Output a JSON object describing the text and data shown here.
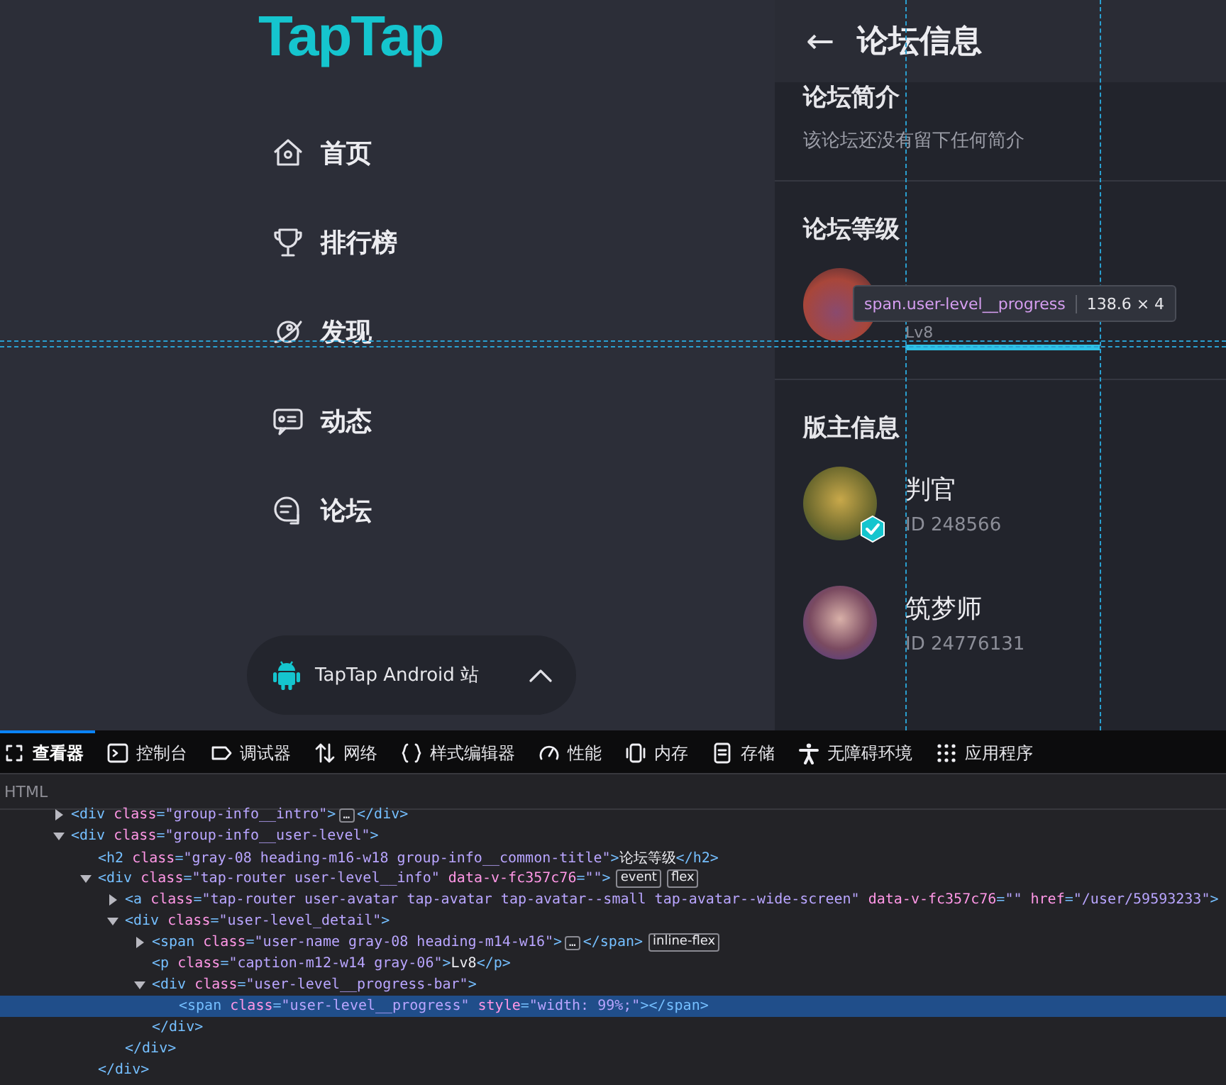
{
  "sidebar": {
    "logo": "TapTap",
    "nav_items": [
      {
        "kind": "home",
        "label": "首页"
      },
      {
        "kind": "trophy",
        "label": "排行榜"
      },
      {
        "kind": "planet",
        "label": "发现"
      },
      {
        "kind": "feed",
        "label": "动态"
      },
      {
        "kind": "forum",
        "label": "论坛"
      }
    ],
    "platform_switch": {
      "label": "TapTap Android 站",
      "expanded": false
    }
  },
  "panel": {
    "back": "←",
    "title": "论坛信息",
    "intro": {
      "heading": "论坛简介",
      "text": "该论坛还没有留下任何简介"
    },
    "level": {
      "heading": "论坛等级",
      "caption": "Lv8",
      "level": 0.99
    },
    "moderators": {
      "heading": "版主信息",
      "items": [
        {
          "name": "判官",
          "id": "ID 248566",
          "verified": true
        },
        {
          "name": "筑梦师",
          "id": "ID 24776131",
          "verified": false
        }
      ]
    }
  },
  "inspector_tooltip": {
    "selector": "span.user-level__progress",
    "size": "138.6 × 4"
  },
  "devtools": {
    "tabs": [
      {
        "kind": "inspector",
        "label": "查看器",
        "selected": true
      },
      {
        "kind": "console",
        "label": "控制台",
        "selected": false
      },
      {
        "kind": "debugger",
        "label": "调试器",
        "selected": false
      },
      {
        "kind": "network",
        "label": "网络",
        "selected": false
      },
      {
        "kind": "style",
        "label": "样式编辑器",
        "selected": false
      },
      {
        "kind": "performance",
        "label": "性能",
        "selected": false
      },
      {
        "kind": "memory",
        "label": "内存",
        "selected": false
      },
      {
        "kind": "storage",
        "label": "存储",
        "selected": false
      },
      {
        "kind": "accessibility",
        "label": "无障碍环境",
        "selected": false
      },
      {
        "kind": "apps",
        "label": "应用程序",
        "selected": false
      }
    ],
    "breadcrumb": "HTML",
    "tree": [
      {
        "open": "<div class=\"group-info__intro\">",
        "inner": "…",
        "close": "</div>",
        "expanded": false,
        "selected": false
      },
      {
        "open": "<div class=\"group-info__user-level\">",
        "expanded": true,
        "selected": false,
        "children": [
          {
            "open": "<h2 class=\"gray-08 heading-m16-w18 group-info__common-title\">",
            "text": "论坛等级",
            "close": "</h2>",
            "selected": false
          },
          {
            "open": "<div class=\"tap-router user-level__info\" data-v-fc357c76=\"\">",
            "badges": [
              "event",
              "flex"
            ],
            "close": "</div>",
            "expanded": true,
            "selected": false,
            "children": [
              {
                "open": "<a class=\"tap-router user-avatar tap-avatar tap-avatar--small tap-avatar--wide-screen\" data-v-fc357c76=\"\" href=\"/user/59593233\">",
                "expanded": false,
                "selected": false
              },
              {
                "open": "<div class=\"user-level_detail\">",
                "close": "</div>",
                "expanded": true,
                "selected": false,
                "children": [
                  {
                    "open": "<span class=\"user-name gray-08 heading-m14-w16\">",
                    "inner": "…",
                    "close": "</span>",
                    "badges": [
                      "inline-flex"
                    ],
                    "expanded": false,
                    "selected": false
                  },
                  {
                    "open": "<p class=\"caption-m12-w14 gray-06\">",
                    "text": "Lv8",
                    "close": "</p>",
                    "selected": false
                  },
                  {
                    "open": "<div class=\"user-level__progress-bar\">",
                    "close": "</div>",
                    "expanded": true,
                    "selected": false,
                    "children": [
                      {
                        "open": "<span class=\"user-level__progress\" style=\"width: 99%;\">",
                        "close": "</span>",
                        "selected": true
                      }
                    ]
                  }
                ]
              }
            ]
          }
        ]
      }
    ]
  }
}
